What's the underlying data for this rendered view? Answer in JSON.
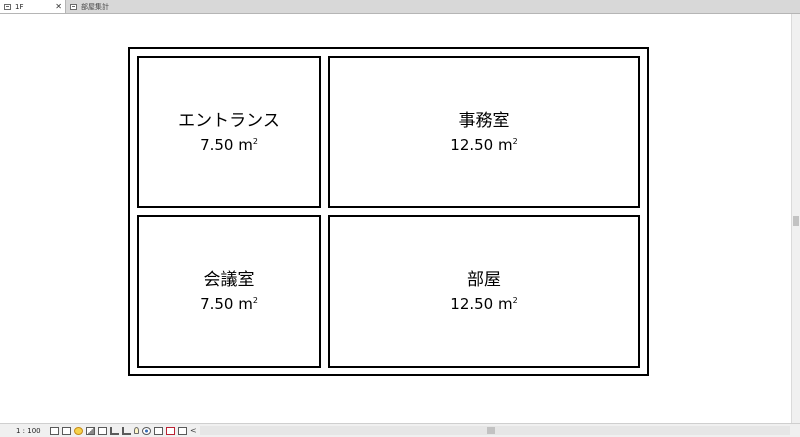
{
  "tabs": [
    {
      "label": "1F",
      "active": true,
      "close_label": "✕"
    },
    {
      "label": "部屋集計",
      "active": false
    }
  ],
  "rooms": [
    {
      "name": "エントランス",
      "area_value": "7.50 m",
      "area_unit_sup": "2"
    },
    {
      "name": "事務室",
      "area_value": "12.50 m",
      "area_unit_sup": "2"
    },
    {
      "name": "会議室",
      "area_value": "7.50 m",
      "area_unit_sup": "2"
    },
    {
      "name": "部屋",
      "area_value": "12.50 m",
      "area_unit_sup": "2"
    }
  ],
  "status": {
    "scale": "1 : 100",
    "scroll_left": "<"
  },
  "icons": {
    "tab_view": "floor-plan-icon",
    "view_controls": [
      "detail-level-icon",
      "visual-style-icon",
      "sun-path-icon",
      "shadows-icon",
      "render-icon",
      "crop-view-icon",
      "show-crop-icon",
      "lamp-icon",
      "temporary-hide-icon",
      "reveal-hidden-icon",
      "analytical-model-icon",
      "highlight-displacement-icon"
    ]
  },
  "colors": {
    "wall": "#000000",
    "tabbar_bg": "#d8d8d8",
    "statusbar_bg": "#f0f0f0"
  }
}
